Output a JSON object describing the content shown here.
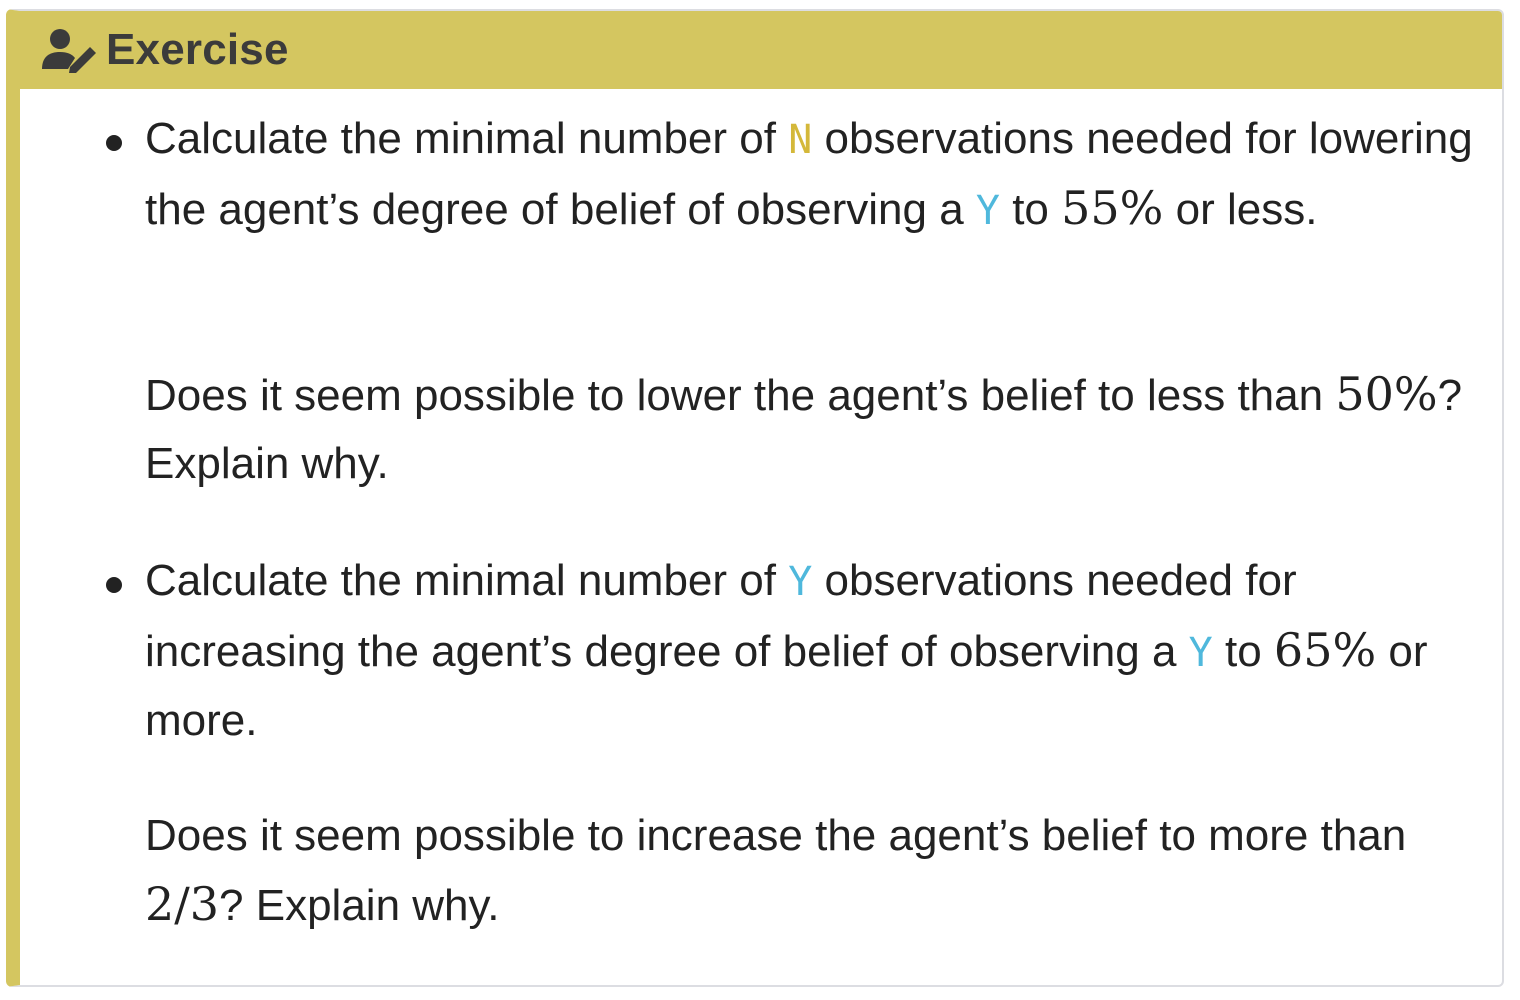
{
  "callout": {
    "title": "Exercise",
    "icon": "user-pen-icon",
    "accent_color": "#d4c660"
  },
  "items": [
    {
      "task": {
        "pre": "Calculate the minimal number of ",
        "code": "N",
        "mid": " observations needed for lowering the agent’s degree of belief of observing a ",
        "code2": "Y",
        "mid2": " to ",
        "math": "55%",
        "post": " or less."
      },
      "question": {
        "pre": "Does it seem possible to lower the agent’s belief to less than ",
        "math": "50%",
        "post": "? Explain why."
      }
    },
    {
      "task": {
        "pre": "Calculate the minimal number of ",
        "code": "Y",
        "mid": " observations needed for increasing the agent’s degree of belief of observing a ",
        "code2": "Y",
        "mid2": " to ",
        "math": "65%",
        "post": " or more."
      },
      "question": {
        "pre": "Does it seem possible to increase the agent’s belief to more than ",
        "math": "2/3",
        "post": "? Explain why."
      }
    }
  ],
  "colors": {
    "code_n": "#d4b83a",
    "code_y": "#4fb8dc",
    "text": "#222222"
  }
}
